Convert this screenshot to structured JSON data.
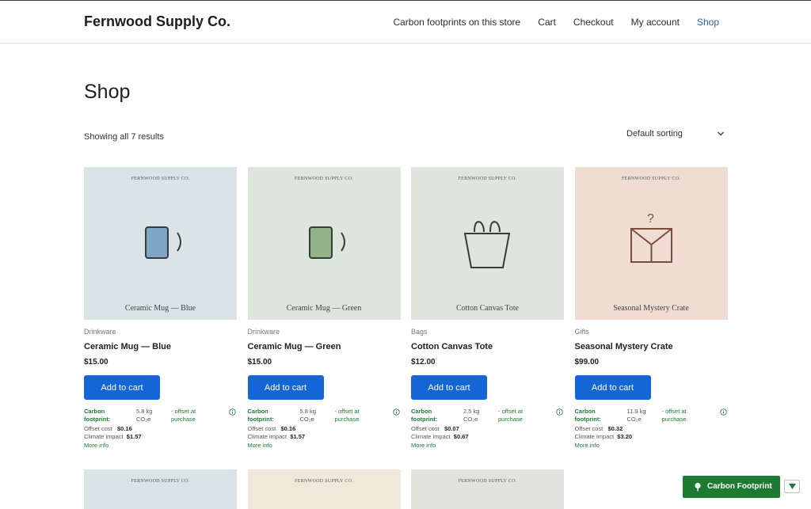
{
  "site": {
    "title": "Fernwood Supply Co."
  },
  "nav": {
    "items": [
      {
        "label": "Carbon footprints on this store"
      },
      {
        "label": "Cart"
      },
      {
        "label": "Checkout"
      },
      {
        "label": "My account"
      },
      {
        "label": "Shop"
      }
    ],
    "active": "Shop"
  },
  "page": {
    "title": "Shop",
    "result_count": "Showing all 7 results",
    "sorting": "Default sorting"
  },
  "brand_mark": "FERNWOOD SUPPLY CO.",
  "carbon_labels": {
    "label": "Carbon footprint:",
    "offset": "- offset at purchase",
    "offset_cost": "Offset cost",
    "climate_impact": "Climate impact",
    "more_info": "More info"
  },
  "products": [
    {
      "image_caption": "Ceramic Mug — Blue",
      "image_bg": "#dae3e6",
      "icon": "mug-icon",
      "icon_color": "#7fa6c6",
      "category": "Drinkware",
      "name": "Ceramic Mug — Blue",
      "price": "$15.00",
      "button": "Add to cart",
      "footprint": "5.8 kg CO₂e",
      "offset_cost": "$0.16",
      "climate_impact": "$1.57"
    },
    {
      "image_caption": "Ceramic Mug — Green",
      "image_bg": "#dce6da",
      "icon": "mug-icon",
      "icon_color": "#93b28a",
      "category": "Drinkware",
      "name": "Ceramic Mug — Green",
      "price": "$15.00",
      "button": "Add to cart",
      "footprint": "5.8 kg CO₂e",
      "offset_cost": "$0.16",
      "climate_impact": "$1.57"
    },
    {
      "image_caption": "Cotton Canvas Tote",
      "image_bg": "#dfe5dc",
      "icon": "tote-bag-icon",
      "icon_color": "#3a3a3a",
      "category": "Bags",
      "name": "Cotton Canvas Tote",
      "price": "$12.00",
      "button": "Add to cart",
      "footprint": "2.5 kg CO₂e",
      "offset_cost": "$0.07",
      "climate_impact": "$0.67"
    },
    {
      "image_caption": "Seasonal Mystery Crate",
      "image_bg": "#efddd3",
      "icon": "mystery-box-icon",
      "icon_color": "#7a4e3a",
      "category": "Gifts",
      "name": "Seasonal Mystery Crate",
      "price": "$99.00",
      "button": "Add to cart",
      "footprint": "11.9 kg CO₂e",
      "offset_cost": "$0.32",
      "climate_impact": "$3.20"
    }
  ],
  "next_row_images": [
    {
      "image_bg": "#dae3e6"
    },
    {
      "image_bg": "#f0e9db"
    },
    {
      "image_bg": "#e3e3de"
    }
  ],
  "widget": {
    "label": "Carbon Footprint",
    "icon": "tree-icon",
    "color": "#1d7a33"
  }
}
